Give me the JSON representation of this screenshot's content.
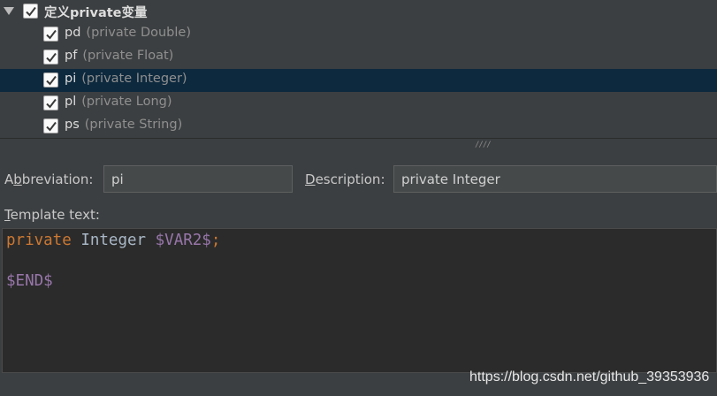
{
  "tree": {
    "group": {
      "label": "定义private变量",
      "checked": true,
      "expanded": true
    },
    "items": [
      {
        "name": "pd",
        "desc": "(private Double)",
        "checked": true,
        "selected": false
      },
      {
        "name": "pf",
        "desc": "(private Float)",
        "checked": true,
        "selected": false
      },
      {
        "name": "pi",
        "desc": "(private Integer)",
        "checked": true,
        "selected": true
      },
      {
        "name": "pl",
        "desc": "(private Long)",
        "checked": true,
        "selected": false
      },
      {
        "name": "ps",
        "desc": "(private String)",
        "checked": true,
        "selected": false
      }
    ]
  },
  "form": {
    "abbreviation_label_a": "A",
    "abbreviation_label_b": "b",
    "abbreviation_label_rest": "breviation:",
    "abbreviation_value": "pi",
    "description_label_d": "D",
    "description_label_rest": "escription:",
    "description_value": "private Integer",
    "template_label_t": "T",
    "template_label_rest": "emplate text:"
  },
  "editor": {
    "line1_kw": "private",
    "line1_type": "Integer",
    "line1_var": "$VAR2$",
    "line1_semi": ";",
    "line3_var": "$END$"
  },
  "watermark": "https://blog.csdn.net/github_39353936",
  "colors": {
    "selection": "#0d293e",
    "keyword": "#cc7832",
    "variable": "#9876aa"
  }
}
